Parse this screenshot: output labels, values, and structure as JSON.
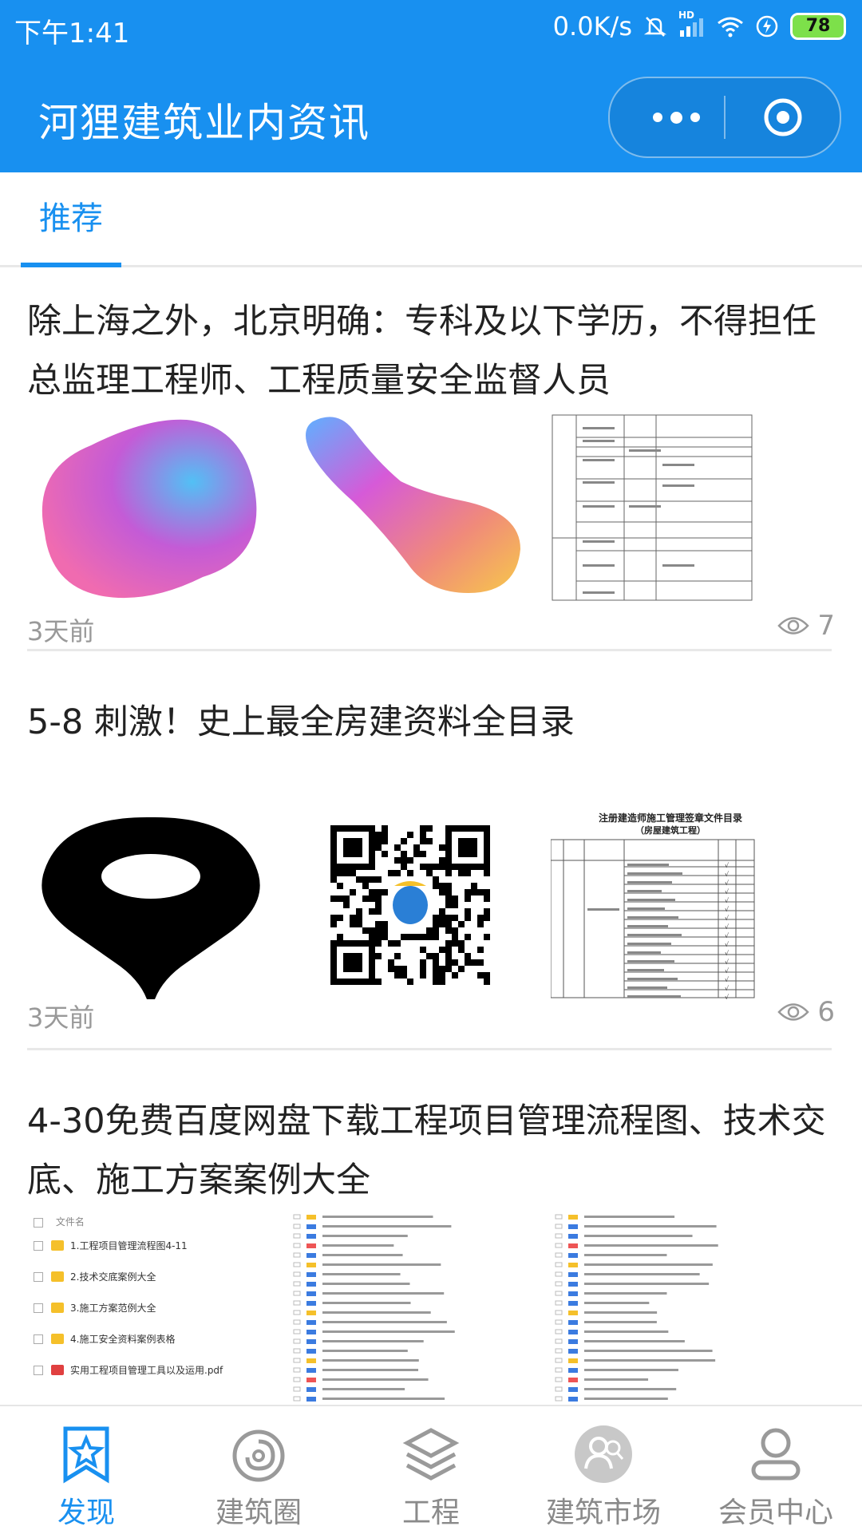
{
  "status_bar": {
    "time": "下午1:41",
    "net_speed": "0.0K/s",
    "hd_label": "HD",
    "battery": "78"
  },
  "header": {
    "title": "河狸建筑业内资讯",
    "more_icon": "more-dots-icon",
    "close_icon": "target-circle-icon"
  },
  "tabs": [
    {
      "label": "推荐",
      "active": true
    }
  ],
  "articles": [
    {
      "title": "除上海之外，北京明确：专科及以下学历，不得担任总监理工程师、工程质量安全监督人员",
      "time": "3天前",
      "views": "7"
    },
    {
      "title": "5-8 刺激！史上最全房建资料全目录",
      "time": "3天前",
      "views": "6"
    },
    {
      "title": "4-30免费百度网盘下载工程项目管理流程图、技术交底、施工方案案例大全"
    }
  ],
  "thumb_texts": {
    "doc_title": "注册建造师施工管理签章文件目录",
    "doc_subtitle": "（房屋建筑工程）",
    "file_header": "文件名",
    "files": [
      "1.工程项目管理流程图4-11",
      "2.技术交底案例大全",
      "3.施工方案范例大全",
      "4.施工安全资料案例表格",
      "实用工程项目管理工具以及运用.pdf"
    ]
  },
  "bottom_nav": [
    {
      "label": "发现",
      "icon": "star-bookmark-icon",
      "active": true
    },
    {
      "label": "建筑圈",
      "icon": "circle-swirl-icon",
      "active": false
    },
    {
      "label": "工程",
      "icon": "layers-icon",
      "active": false
    },
    {
      "label": "建筑市场",
      "icon": "people-search-icon",
      "active": false
    },
    {
      "label": "会员中心",
      "icon": "user-icon",
      "active": false
    }
  ],
  "colors": {
    "primary": "#1890f0",
    "text": "#222222",
    "muted": "#999999",
    "battery": "#7de04a"
  }
}
